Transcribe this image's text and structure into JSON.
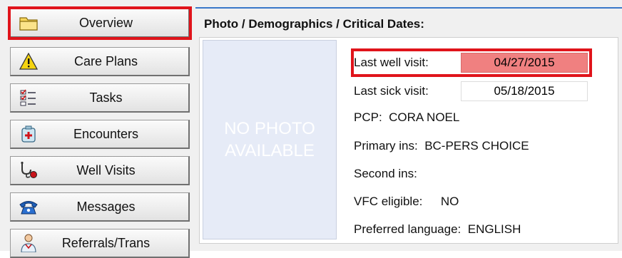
{
  "nav": {
    "items": [
      {
        "label": "Overview",
        "icon": "folder-icon"
      },
      {
        "label": "Care Plans",
        "icon": "warning-icon"
      },
      {
        "label": "Tasks",
        "icon": "checklist-icon"
      },
      {
        "label": "Encounters",
        "icon": "medical-kit-icon"
      },
      {
        "label": "Well Visits",
        "icon": "stethoscope-icon"
      },
      {
        "label": "Messages",
        "icon": "telephone-icon"
      },
      {
        "label": "Referrals/Trans",
        "icon": "doctor-icon"
      }
    ],
    "active_index": 0
  },
  "section": {
    "title": "Photo / Demographics / Critical Dates:"
  },
  "photo": {
    "line1": "NO PHOTO",
    "line2": "AVAILABLE"
  },
  "demographics": {
    "last_well_label": "Last well visit:",
    "last_well_value": "04/27/2015",
    "last_sick_label": "Last sick visit:",
    "last_sick_value": "05/18/2015",
    "pcp_label": "PCP:",
    "pcp_value": "CORA NOEL",
    "primary_ins_label": "Primary ins:",
    "primary_ins_value": "BC-PERS CHOICE",
    "second_ins_label": "Second ins:",
    "second_ins_value": "",
    "vfc_label": "VFC eligible:",
    "vfc_value": "NO",
    "language_label": "Preferred language:",
    "language_value": "ENGLISH"
  },
  "colors": {
    "highlight_red": "#e0141b",
    "overdue_fill": "#f08080",
    "accent_blue": "#3b78c9"
  }
}
